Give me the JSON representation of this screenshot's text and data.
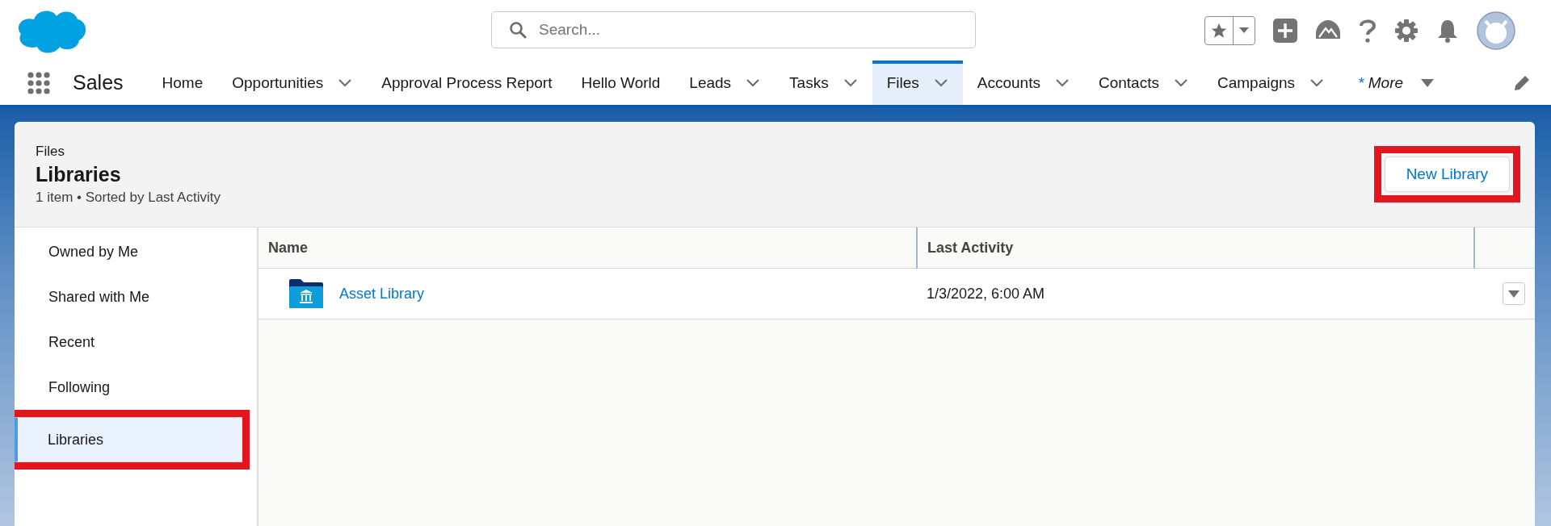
{
  "header": {
    "search": {
      "placeholder": "Search..."
    }
  },
  "nav": {
    "app_name": "Sales",
    "tabs": [
      {
        "label": "Home",
        "has_menu": false,
        "selected": false
      },
      {
        "label": "Opportunities",
        "has_menu": true,
        "selected": false
      },
      {
        "label": "Approval Process Report",
        "has_menu": false,
        "selected": false
      },
      {
        "label": "Hello World",
        "has_menu": false,
        "selected": false
      },
      {
        "label": "Leads",
        "has_menu": true,
        "selected": false
      },
      {
        "label": "Tasks",
        "has_menu": true,
        "selected": false
      },
      {
        "label": "Files",
        "has_menu": true,
        "selected": true
      },
      {
        "label": "Accounts",
        "has_menu": true,
        "selected": false
      },
      {
        "label": "Contacts",
        "has_menu": true,
        "selected": false
      },
      {
        "label": "Campaigns",
        "has_menu": true,
        "selected": false
      }
    ],
    "more": {
      "asterisk": "*",
      "label": "More"
    }
  },
  "page_header": {
    "object": "Files",
    "title": "Libraries",
    "meta": "1 item • Sorted by Last Activity",
    "button": {
      "label": "New Library",
      "highlighted": true
    }
  },
  "sidebar": {
    "items": [
      {
        "label": "Owned by Me",
        "selected": false,
        "highlighted": false
      },
      {
        "label": "Shared with Me",
        "selected": false,
        "highlighted": false
      },
      {
        "label": "Recent",
        "selected": false,
        "highlighted": false
      },
      {
        "label": "Following",
        "selected": false,
        "highlighted": false
      },
      {
        "label": "Libraries",
        "selected": true,
        "highlighted": true
      }
    ]
  },
  "table": {
    "columns": [
      "Name",
      "Last Activity"
    ],
    "rows": [
      {
        "name": "Asset Library",
        "last_activity": "1/3/2022, 6:00 AM"
      }
    ]
  }
}
